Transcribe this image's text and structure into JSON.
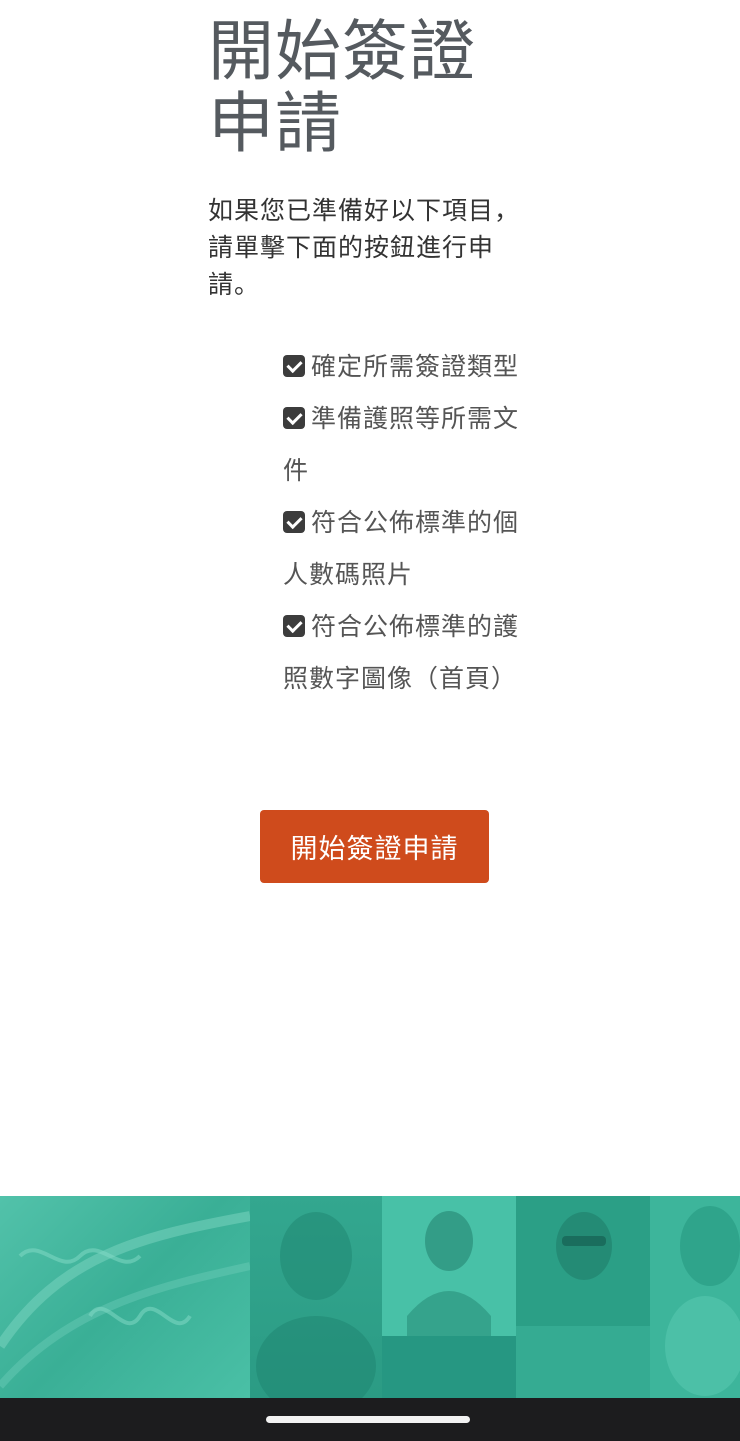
{
  "title": "開始簽證申請",
  "intro": "如果您已準備好以下項目，請單擊下面的按鈕進行申請。",
  "checklist": [
    "確定所需簽證類型",
    "準備護照等所需文件",
    "符合公佈標準的個人數碼照片",
    "符合公佈標準的護照數字圖像（首頁）"
  ],
  "start_button_label": "開始簽證申請",
  "icons": {
    "checkbox": "check-square-icon"
  },
  "colors": {
    "button": "#cf4b1c",
    "banner": "#2fb196",
    "title": "#555a5f",
    "nav_bar": "#1c1c1e"
  }
}
